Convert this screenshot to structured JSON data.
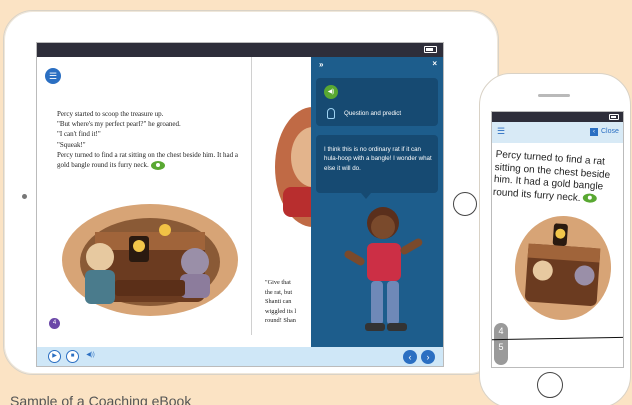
{
  "tablet": {
    "story_text": "Percy started to scoop the treasure up.\n\"But where's my perfect pearl?\" he groaned.\n\"I can't find it!\"\n\"Squeak!\"\nPercy turned to find a rat sitting on the chest beside him. It had a gold bangle round its furry neck.",
    "page_number": "4",
    "right_page_text": "\"Give that\nthe rat, but\nShanti can\nwiggled its l\nround! Shan",
    "panel": {
      "expand_label": "»",
      "close_label": "×",
      "question_label": "Question and predict",
      "think_text": "I think this is no ordinary rat if it can hula-hoop with a bangle! I wonder what else it will do."
    },
    "controls": {
      "play": "▶",
      "stop": "■",
      "audio": "◀))",
      "prev": "‹",
      "next": "›"
    }
  },
  "phone": {
    "menu_label": "☰",
    "close_label": "Close",
    "text": "Percy turned to find a rat sitting on the chest beside him. It had a gold bangle round its furry neck.",
    "page_numbers": [
      "4",
      "5"
    ]
  },
  "caption": "Sample of a Coaching eBook"
}
